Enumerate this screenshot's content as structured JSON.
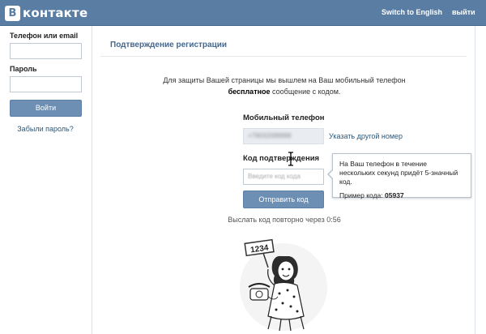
{
  "header": {
    "logo_letter": "В",
    "logo_text": "контакте",
    "switch_lang": "Switch to English",
    "logout": "выйти",
    "bg_color": "#597da3"
  },
  "login": {
    "phone_label": "Телефон или email",
    "phone_value": "",
    "password_label": "Пароль",
    "password_value": "",
    "login_button": "Войти",
    "forgot_link": "Забыли пароль?"
  },
  "main": {
    "title": "Подтверждение регистрации",
    "intro_line1": "Для защиты Вашей страницы мы вышлем на Ваш мобильный телефон",
    "intro_line2_bold": "бесплатное",
    "intro_line2_rest": " сообщение с кодом.",
    "phone_section_title": "Мобильный телефон",
    "phone_value_blurred": "+79032099999",
    "change_number_link": "Указать другой номер",
    "code_section_title": "Код подтверждения",
    "code_placeholder": "Введите код кода",
    "send_button": "Отправить код",
    "resend_text": "Выслать код повторно через 0:56"
  },
  "tooltip": {
    "text": "На Ваш телефон в течение нескольких секунд придёт 5-значный код.",
    "example_label": "Пример кода:",
    "example_code": "05937"
  },
  "illustration": {
    "sign_text": "1234",
    "icon": "girl-with-phone-illustration"
  },
  "colors": {
    "accent": "#597da3",
    "button": "#6d8fb3",
    "link": "#2b587a",
    "title": "#45688e"
  }
}
